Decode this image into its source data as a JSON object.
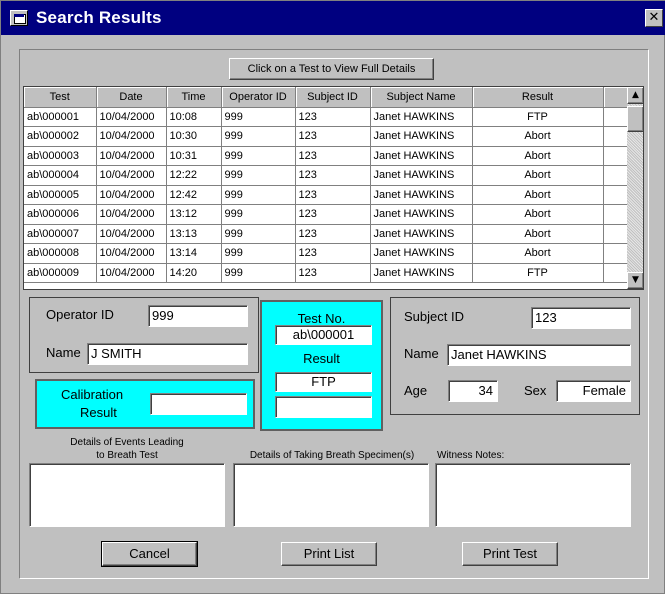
{
  "window": {
    "title": "Search Results",
    "close_glyph": "✕",
    "sys_icon": "window-menu-icon"
  },
  "hint_button": "Click on a Test to View Full Details",
  "results_table": {
    "columns": [
      "Test",
      "Date",
      "Time",
      "Operator ID",
      "Subject ID",
      "Subject  Name",
      "Result"
    ],
    "rows": [
      [
        "ab\\000001",
        "10/04/2000",
        "10:08",
        "999",
        "123",
        "Janet HAWKINS",
        "FTP"
      ],
      [
        "ab\\000002",
        "10/04/2000",
        "10:30",
        "999",
        "123",
        "Janet HAWKINS",
        "Abort"
      ],
      [
        "ab\\000003",
        "10/04/2000",
        "10:31",
        "999",
        "123",
        "Janet HAWKINS",
        "Abort"
      ],
      [
        "ab\\000004",
        "10/04/2000",
        "12:22",
        "999",
        "123",
        "Janet HAWKINS",
        "Abort"
      ],
      [
        "ab\\000005",
        "10/04/2000",
        "12:42",
        "999",
        "123",
        "Janet HAWKINS",
        "Abort"
      ],
      [
        "ab\\000006",
        "10/04/2000",
        "13:12",
        "999",
        "123",
        "Janet HAWKINS",
        "Abort"
      ],
      [
        "ab\\000007",
        "10/04/2000",
        "13:13",
        "999",
        "123",
        "Janet HAWKINS",
        "Abort"
      ],
      [
        "ab\\000008",
        "10/04/2000",
        "13:14",
        "999",
        "123",
        "Janet HAWKINS",
        "Abort"
      ],
      [
        "ab\\000009",
        "10/04/2000",
        "14:20",
        "999",
        "123",
        "Janet HAWKINS",
        "FTP"
      ]
    ],
    "scroll_up_glyph": "▲",
    "scroll_down_glyph": "▼"
  },
  "operator": {
    "id_label": "Operator ID",
    "id_value": "999",
    "name_label": "Name",
    "name_value": "J SMITH"
  },
  "calibration": {
    "label_line1": "Calibration",
    "label_line2": "Result",
    "value": ""
  },
  "test": {
    "number_label": "Test No.",
    "number_value": "ab\\000001",
    "result_label": "Result",
    "result_value": "FTP",
    "extra_value": ""
  },
  "subject": {
    "id_label": "Subject ID",
    "id_value": "123",
    "name_label": "Name",
    "name_value": "Janet HAWKINS",
    "age_label": "Age",
    "age_value": "34",
    "sex_label": "Sex",
    "sex_value": "Female"
  },
  "notes": {
    "events_label_line1": "Details of Events Leading",
    "events_label_line2": "to Breath Test",
    "events_value": "",
    "specimen_label": "Details of Taking Breath Specimen(s)",
    "specimen_value": "",
    "witness_label": "Witness Notes:",
    "witness_value": ""
  },
  "buttons": {
    "cancel": "Cancel",
    "print_list": "Print List",
    "print_test": "Print Test"
  },
  "colors": {
    "titlebar": "#000080",
    "face": "#c0c0c0",
    "highlight_panel": "#00ffff"
  }
}
